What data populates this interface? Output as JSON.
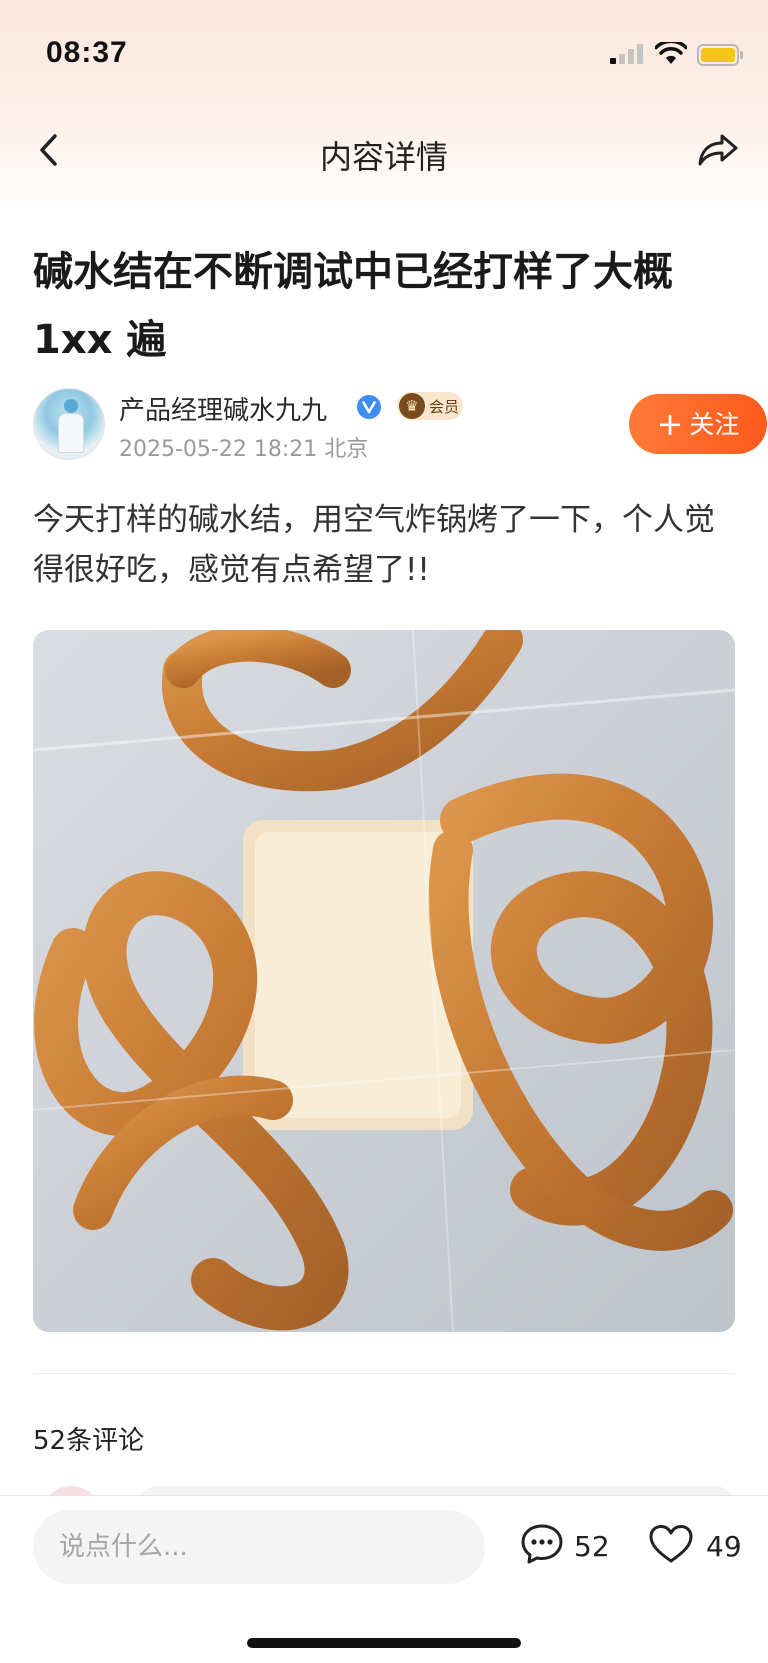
{
  "status_bar": {
    "time": "08:37"
  },
  "nav": {
    "title": "内容详情",
    "back_icon": "chevron-left-icon",
    "share_icon": "share-arrow-icon"
  },
  "post": {
    "title": "碱水结在不断调试中已经打样了大概1xx 遍",
    "author": {
      "name": "产品经理碱水九九",
      "member_label": "会员",
      "verified_icon": "verified-v-icon"
    },
    "meta": "2025-05-22 18:21 北京",
    "follow_label": "关注",
    "body": "今天打样的碱水结，用空气炸锅烤了一下，个人觉得很好吃，感觉有点希望了!!"
  },
  "comments": {
    "header": "52条评论"
  },
  "bottom_bar": {
    "input_placeholder": "说点什么...",
    "comment_count": "52",
    "like_count": "49"
  },
  "colors": {
    "accent": "#ff6a2a",
    "verified": "#3d8ef0",
    "badge_bg": "#fae6cf"
  }
}
